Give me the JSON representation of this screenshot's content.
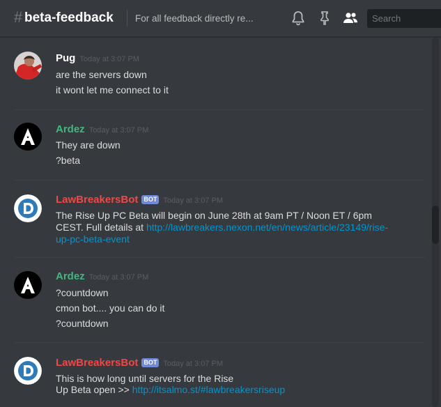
{
  "header": {
    "hash": "#",
    "channel": "beta-feedback",
    "topic": "For all feedback directly re...",
    "search_placeholder": "Search",
    "icons": [
      "bell-icon",
      "pin-icon",
      "members-icon"
    ]
  },
  "colors": {
    "background": "#36393e",
    "ardez": "#43b581",
    "bot": "#f04747",
    "link": "#0096cf",
    "bot_tag": "#7289da"
  },
  "messages": [
    {
      "author": "Pug",
      "timestamp": "Today at 3:07 PM",
      "lines": [
        "are the servers down",
        "it wont let me connect to it"
      ]
    },
    {
      "author": "Ardez",
      "timestamp": "Today at 3:07 PM",
      "lines": [
        "They are down",
        "?beta"
      ]
    },
    {
      "author": "LawBreakersBot",
      "bot_tag": "BOT",
      "timestamp": "Today at 3:07 PM",
      "line1": "The Rise Up PC Beta will begin on June 28th at 9am PT / Noon ET / 6pm",
      "line2_text": "CEST. Full details at ",
      "line2_link": "http://lawbreakers.nexon.net/en/news/article/23149/rise-",
      "line3_link": "up-pc-beta-event"
    },
    {
      "author": "Ardez",
      "timestamp": "Today at 3:07 PM",
      "lines": [
        "?countdown",
        "cmon bot.... you can do it",
        "?countdown"
      ]
    },
    {
      "author": "LawBreakersBot",
      "bot_tag": "BOT",
      "timestamp": "Today at 3:07 PM",
      "line1": "This is how long until servers for the Rise",
      "line2_text": " Up Beta open >> ",
      "line2_link": "http://itsalmo.st/#lawbreakersriseup"
    }
  ]
}
